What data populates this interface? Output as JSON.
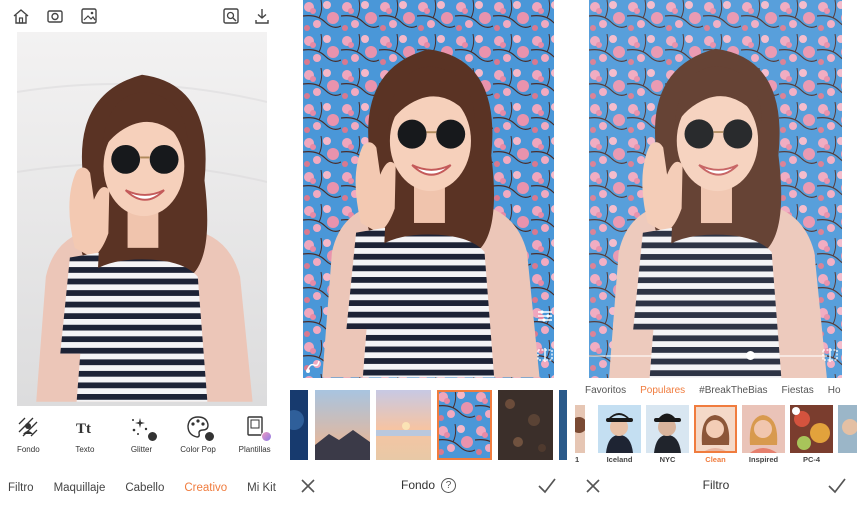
{
  "colors": {
    "accent": "#f07c3e",
    "text": "#333333",
    "sky": "#3a8fd6",
    "blossom": "#e89ab0"
  },
  "panel_editor": {
    "top_icons": [
      "home-icon",
      "camera-icon",
      "gallery-icon",
      "search-photo-icon",
      "download-icon"
    ],
    "tools": [
      {
        "label": "Fondo",
        "icon": "background-icon"
      },
      {
        "label": "Texto",
        "icon": "text-icon"
      },
      {
        "label": "Glitter",
        "icon": "glitter-icon"
      },
      {
        "label": "Color Pop",
        "icon": "color-pop-icon"
      },
      {
        "label": "Plantillas",
        "icon": "templates-icon"
      }
    ],
    "categories": [
      {
        "label": "Filtro",
        "active": false
      },
      {
        "label": "Maquillaje",
        "active": false
      },
      {
        "label": "Cabello",
        "active": false
      },
      {
        "label": "Creativo",
        "active": true
      },
      {
        "label": "Mi Kit",
        "active": false
      }
    ]
  },
  "panel_background": {
    "title": "Fondo",
    "help": "?",
    "thumbnails": [
      "night-sky",
      "mountain-sunset",
      "beach-sunset",
      "cherry-blossom",
      "dark-texture",
      "partial"
    ],
    "selected_thumbnail": 3
  },
  "panel_filter": {
    "title": "Filtro",
    "intensity": 0.68,
    "tabs": [
      {
        "label": "Favoritos",
        "active": false
      },
      {
        "label": "Populares",
        "active": true
      },
      {
        "label": "#BreakTheBias",
        "active": false
      },
      {
        "label": "Fiestas",
        "active": false
      },
      {
        "label": "Ho",
        "active": false
      }
    ],
    "filters": [
      {
        "label": "1",
        "selected": false
      },
      {
        "label": "Iceland",
        "selected": false
      },
      {
        "label": "NYC",
        "selected": false
      },
      {
        "label": "Clean",
        "selected": true
      },
      {
        "label": "Inspired",
        "selected": false
      },
      {
        "label": "PC-4",
        "selected": false
      },
      {
        "label": "",
        "selected": false
      }
    ]
  }
}
